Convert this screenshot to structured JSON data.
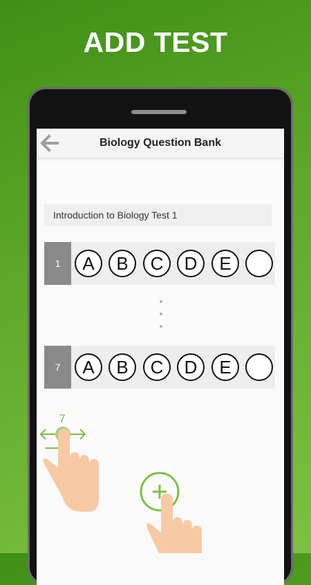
{
  "headline": "ADD TEST",
  "app_bar": {
    "title": "Biology Question Bank",
    "back_icon": "arrow-left-icon"
  },
  "test": {
    "name": "Introduction to Biology Test 1"
  },
  "questions": [
    {
      "number": "1",
      "options": [
        "A",
        "B",
        "C",
        "D",
        "E",
        ""
      ]
    },
    {
      "number": "7",
      "options": [
        "A",
        "B",
        "C",
        "D",
        "E",
        ""
      ]
    }
  ],
  "gesture_hint": {
    "value": "7",
    "icons": [
      "swipe-hand-icon",
      "tap-hand-icon",
      "add-circle-icon"
    ]
  },
  "colors": {
    "accent_green": "#7cc142",
    "number_cell": "#8a8a8a",
    "hand": "#f7c9a4"
  }
}
